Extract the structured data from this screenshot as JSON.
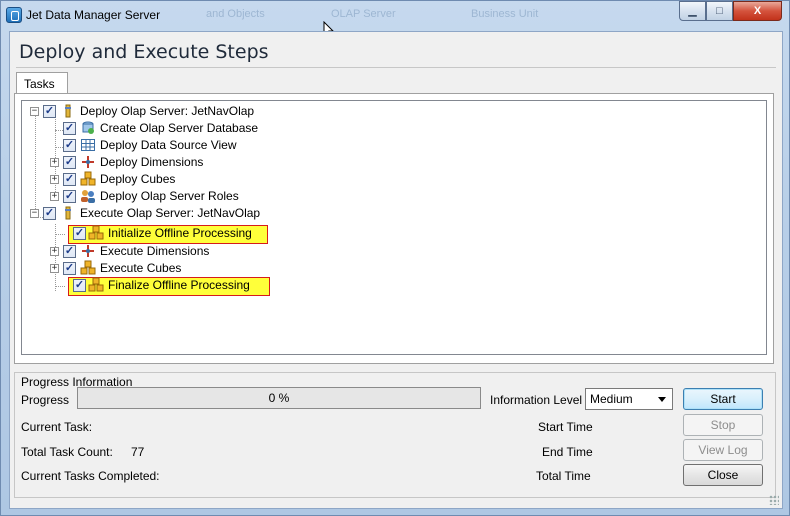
{
  "window": {
    "title": "Jet Data Manager Server",
    "ghost_titles": [
      "and Objects",
      "OLAP Server",
      "Business Unit"
    ],
    "controls": {
      "minimize": "▁",
      "maximize": "□",
      "close": "X"
    }
  },
  "header": {
    "title": "Deploy and Execute Steps"
  },
  "tabs": [
    {
      "label": "Tasks"
    }
  ],
  "tree": {
    "nodes": [
      {
        "label": "Deploy Olap Server: JetNavOlap",
        "checked": "✓",
        "expander": "−",
        "icon": "server-pin-icon"
      },
      {
        "label": "Create Olap Server Database",
        "checked": "✓",
        "icon": "database-icon"
      },
      {
        "label": "Deploy Data Source View",
        "checked": "✓",
        "icon": "grid-icon"
      },
      {
        "label": "Deploy Dimensions",
        "checked": "✓",
        "expander": "+",
        "icon": "dimensions-icon"
      },
      {
        "label": "Deploy Cubes",
        "checked": "✓",
        "expander": "+",
        "icon": "cubes-icon"
      },
      {
        "label": "Deploy Olap Server Roles",
        "checked": "✓",
        "expander": "+",
        "icon": "users-icon"
      },
      {
        "label": "Execute Olap Server: JetNavOlap",
        "checked": "✓",
        "expander": "−",
        "icon": "server-pin-icon"
      },
      {
        "label": "Initialize Offline Processing",
        "checked": "✓",
        "icon": "cubes-icon",
        "highlighted": true
      },
      {
        "label": "Execute Dimensions",
        "checked": "✓",
        "expander": "+",
        "icon": "dimensions-icon"
      },
      {
        "label": "Execute Cubes",
        "checked": "✓",
        "expander": "+",
        "icon": "cubes-icon"
      },
      {
        "label": "Finalize Offline Processing",
        "checked": "✓",
        "icon": "cubes-icon",
        "highlighted": true
      }
    ]
  },
  "progress": {
    "group_label": "Progress Information",
    "progress_label": "Progress",
    "progress_value": 0,
    "progress_text": "0 %",
    "information_level_label": "Information Level",
    "information_level_value": "Medium",
    "current_task_label": "Current Task:",
    "total_task_count_label": "Total Task Count:",
    "total_task_count_value": "77",
    "current_tasks_completed_label": "Current Tasks Completed:",
    "start_time_label": "Start Time",
    "end_time_label": "End Time",
    "total_time_label": "Total Time"
  },
  "buttons": {
    "start": "Start",
    "stop": "Stop",
    "view_log": "View Log",
    "close": "Close"
  },
  "colors": {
    "highlight_fill": "#ffff3a",
    "highlight_border": "#d61b1b",
    "window_frame": "#b9d1ea"
  }
}
